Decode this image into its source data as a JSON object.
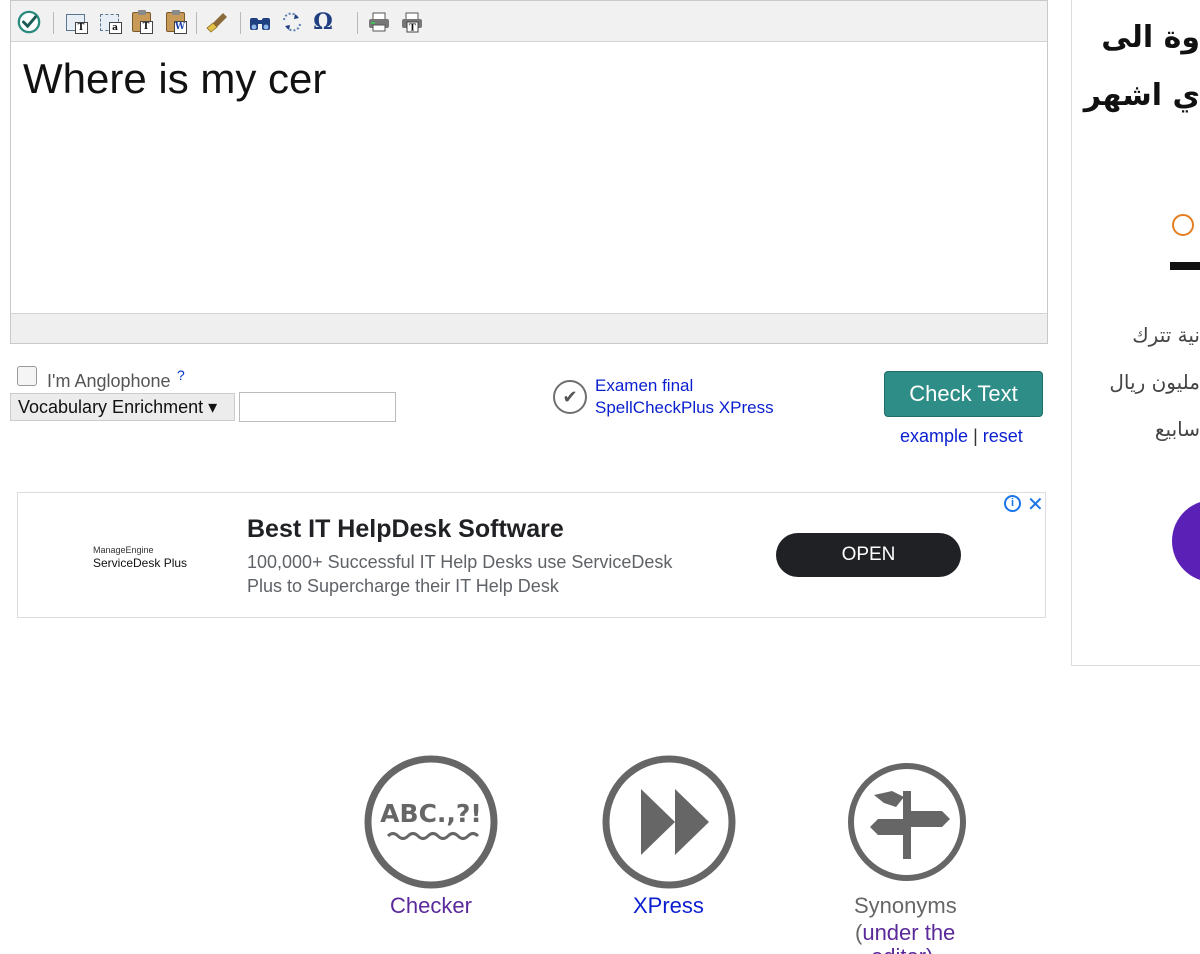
{
  "editor": {
    "text": "Where is my cer",
    "toolbar": [
      {
        "name": "spellcheck-icon"
      },
      {
        "name": "copy-text-icon"
      },
      {
        "name": "copy-alt-icon"
      },
      {
        "name": "paste-text-icon"
      },
      {
        "name": "paste-word-icon"
      },
      {
        "name": "clear-format-icon"
      },
      {
        "name": "find-icon"
      },
      {
        "name": "replace-icon"
      },
      {
        "name": "special-char-icon"
      },
      {
        "name": "print-icon"
      },
      {
        "name": "print-preview-icon"
      }
    ],
    "special_char_glyph": "Ω"
  },
  "controls": {
    "anglophone_label": "I'm Anglophone",
    "anglophone_help": "?",
    "vocab_select": "Vocabulary Enrichment ▾",
    "vocab_input_value": "",
    "exam_line1": "Examen final",
    "exam_line2": "SpellCheckPlus XPress",
    "check_button": "Check Text",
    "example_link": "example",
    "separator": "|",
    "reset_link": "reset"
  },
  "ad": {
    "brand_small": "ManageEngine",
    "brand_main": "ServiceDesk Plus",
    "title": "Best IT HelpDesk Software",
    "desc_line1": "100,000+ Successful IT Help Desks use ServiceDesk",
    "desc_line2": "Plus to Supercharge their IT Help Desk",
    "cta": "OPEN",
    "info_glyph": "i",
    "close_glyph": "✕"
  },
  "sidebar": {
    "heading_line1": "وة الى",
    "heading_line2": "ي اشهر",
    "para_line1": "نية تترك",
    "para_line2": "مليون ريال",
    "para_line3": "سابيع"
  },
  "bottom_nav": {
    "checker_icon_text": "ABC.,?!",
    "checker_label": "Checker",
    "xpress_label": "XPress",
    "synonyms_label": "Synonyms",
    "synonyms_paren_open": "(",
    "synonyms_note_line1": "under the",
    "synonyms_note_line2": "editor)"
  },
  "colors": {
    "check_button": "#2e8d86",
    "link": "#0a1fcf",
    "visited_link": "#5b2a9a",
    "ad_cta": "#202124",
    "sidebar_circle": "#5b21b6"
  }
}
